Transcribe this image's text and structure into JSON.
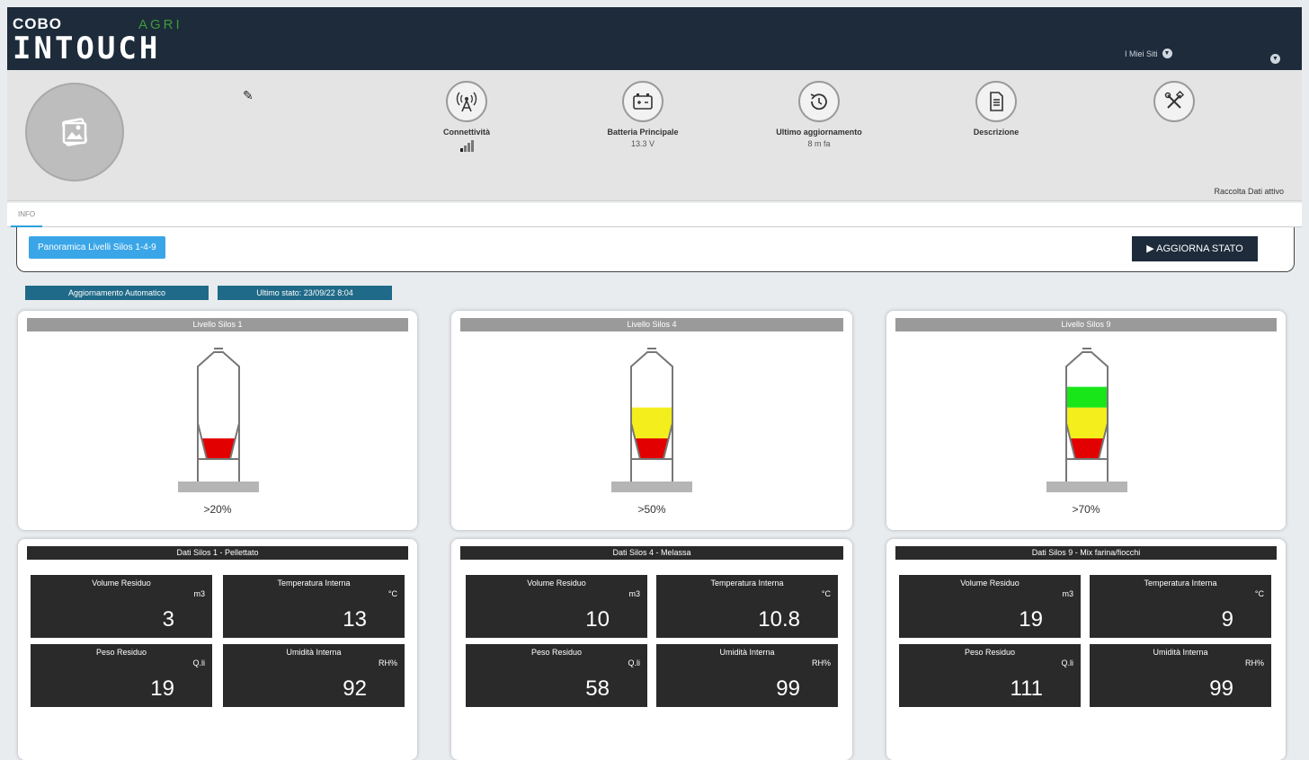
{
  "app": {
    "brand_top": "COBO",
    "brand_sub": "AGRI",
    "brand_main": "INTOUCH"
  },
  "user_menu": {
    "label": "I Miei Siti"
  },
  "header": {
    "stats": [
      {
        "label": "Connettività",
        "value": "",
        "icon": "antenna-icon"
      },
      {
        "label": "Batteria Principale",
        "value": "13.3 V",
        "icon": "battery-icon"
      },
      {
        "label": "Ultimo aggiornamento",
        "value": "8 m fa",
        "icon": "history-icon"
      },
      {
        "label": "Descrizione",
        "value": "",
        "icon": "document-icon"
      },
      {
        "label": "",
        "value": "",
        "icon": "tools-icon"
      }
    ],
    "status_text": "Raccolta Dati attivo"
  },
  "tabs": [
    {
      "label": "INFO"
    }
  ],
  "actions": {
    "panoramica": "Panoramica Livelli Silos 1-4-9",
    "aggiorna": "▶ AGGIORNA STATO"
  },
  "status": {
    "auto": "Aggiornamento Automatico",
    "last": "Ultimo stato: 23/09/22 8:04"
  },
  "silos": [
    {
      "title": "Livello Silos 1",
      "level_label": ">20%",
      "level_fraction": 0.2,
      "data_title": "Dati Silos 1 - Pellettato",
      "tiles": [
        {
          "label": "Volume Residuo",
          "unit": "m3",
          "value": "3"
        },
        {
          "label": "Temperatura Interna",
          "unit": "°C",
          "value": "13"
        },
        {
          "label": "Peso Residuo",
          "unit": "Q.li",
          "value": "19"
        },
        {
          "label": "Umidità Interna",
          "unit": "RH%",
          "value": "92"
        }
      ]
    },
    {
      "title": "Livello Silos 4",
      "level_label": ">50%",
      "level_fraction": 0.5,
      "data_title": "Dati Silos 4 - Melassa",
      "tiles": [
        {
          "label": "Volume Residuo",
          "unit": "m3",
          "value": "10"
        },
        {
          "label": "Temperatura Interna",
          "unit": "°C",
          "value": "10.8"
        },
        {
          "label": "Peso Residuo",
          "unit": "Q.li",
          "value": "58"
        },
        {
          "label": "Umidità Interna",
          "unit": "RH%",
          "value": "99"
        }
      ]
    },
    {
      "title": "Livello Silos 9",
      "level_label": ">70%",
      "level_fraction": 0.7,
      "data_title": "Dati Silos 9 - Mix farina/fiocchi",
      "tiles": [
        {
          "label": "Volume Residuo",
          "unit": "m3",
          "value": "19"
        },
        {
          "label": "Temperatura Interna",
          "unit": "°C",
          "value": "9"
        },
        {
          "label": "Peso Residuo",
          "unit": "Q.li",
          "value": "111"
        },
        {
          "label": "Umidità Interna",
          "unit": "RH%",
          "value": "99"
        }
      ]
    }
  ],
  "colors": {
    "navy": "#1d2b3b",
    "accent_blue": "#3aa6e8",
    "teal": "#1f6a88",
    "level_red": "#e30000",
    "level_yellow": "#f3ee1c",
    "level_green": "#19e619",
    "agri_green": "#3c9b3a"
  }
}
